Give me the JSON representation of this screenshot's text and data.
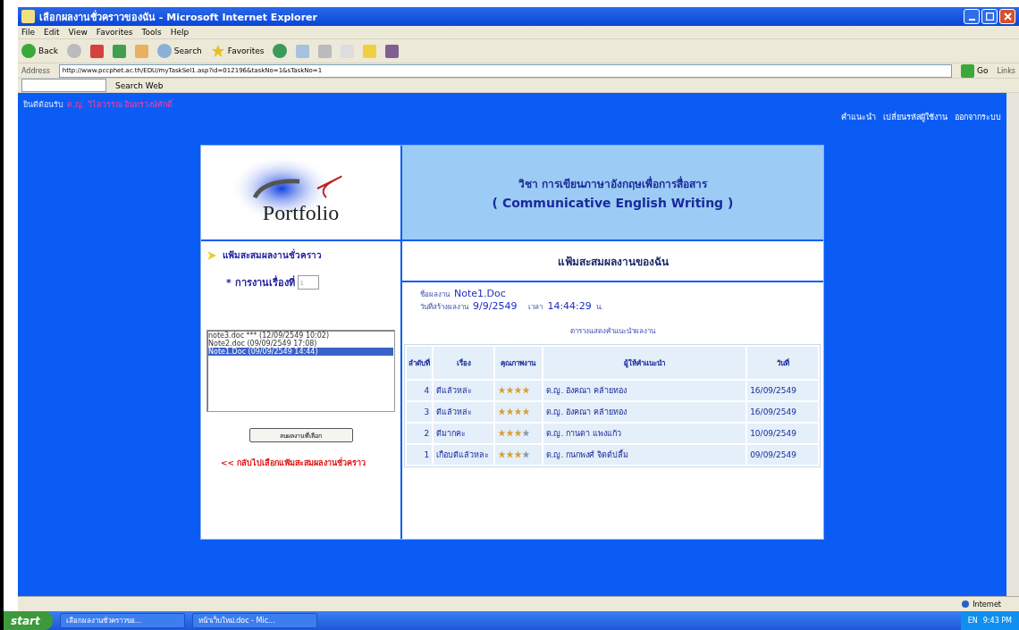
{
  "window": {
    "title": "เลือกผลงานชั่วคราวของฉัน - Microsoft Internet Explorer"
  },
  "menu": [
    "File",
    "Edit",
    "View",
    "Favorites",
    "Tools",
    "Help"
  ],
  "toolbar": {
    "back": "Back",
    "search": "Search",
    "favorites": "Favorites"
  },
  "address": {
    "label": "Address",
    "url": "http://www.pccphet.ac.th/EDU/myTaskSel1.asp?id=012196&taskNo=1&sTaskNo=1",
    "go": "Go",
    "links": "Links"
  },
  "search_bar": {
    "button": "Search Web"
  },
  "page": {
    "welcome": "ยินดีต้อนรับ",
    "user": "ด.ญ. วิไลวรรณ อินทรวงษ์ศักดิ์",
    "nav": [
      "คำแนะนำ",
      "เปลี่ยนรหัสผู้ใช้งาน",
      "ออกจากระบบ"
    ],
    "logo": "Portfolio",
    "course_title": "วิชา การเขียนภาษาอังกฤษเพื่อการสื่อสาร",
    "course_subtitle": "( Communicative English Writing )",
    "sidebar_title": "แฟ้มสะสมผลงานชั่วคราว",
    "task_label": "* การงานเรื่องที่",
    "task_value": "1",
    "files": [
      {
        "label": "note3.doc *** (12/09/2549 10:02)",
        "selected": false
      },
      {
        "label": "Note2.doc (09/09/2549 17:08)",
        "selected": false
      },
      {
        "label": "Note1.Doc (09/09/2549 14:44)",
        "selected": true
      }
    ],
    "delete_button": "ลบผลงานที่เลือก",
    "back_link": "<< กลับไปเลือกแฟ้มสะสมผลงานชั่วคราว",
    "section_title": "แฟ้มสะสมผลงานของฉัน",
    "work_name_label": "ชื่อผลงาน",
    "work_name": "Note1.Doc",
    "created_label": "วันที่สร้างผลงาน",
    "created_date": "9/9/2549",
    "time_label": "เวลา",
    "time": "14:44:29",
    "time_unit": "น.",
    "table_caption": "ตารางแสดงคำแนะนำผลงาน",
    "columns": [
      "ลำดับที่",
      "เรื่อง",
      "คุณภาพงาน",
      "ผู้ให้คำแนะนำ",
      "วันที่"
    ],
    "rows": [
      {
        "no": "4",
        "subject": "ดีแล้วหล่ะ",
        "stars": 4,
        "advisor": "ด.ญ. อังคณา คล้ายทอง",
        "date": "16/09/2549"
      },
      {
        "no": "3",
        "subject": "ดีแล้วหล่ะ",
        "stars": 4,
        "advisor": "ด.ญ. อังคณา คล้ายทอง",
        "date": "16/09/2549"
      },
      {
        "no": "2",
        "subject": "ดีมากคะ",
        "stars": 3,
        "advisor": "ด.ญ. กานดา แพงแก้ว",
        "date": "10/09/2549"
      },
      {
        "no": "1",
        "subject": "เกือบดีแล้วหละ",
        "stars": 3,
        "advisor": "ด.ญ. กนกพงศ์ จิตต์ปลื้ม",
        "date": "09/09/2549"
      }
    ]
  },
  "status_bar": {
    "zone": "Internet"
  },
  "taskbar": {
    "start": "start",
    "tasks": [
      "เลือกผลงานชั่วคราวขอ...",
      "หน้าเว็บใหม่.doc - Mic..."
    ],
    "language": "EN",
    "clock": "9:43 PM"
  }
}
